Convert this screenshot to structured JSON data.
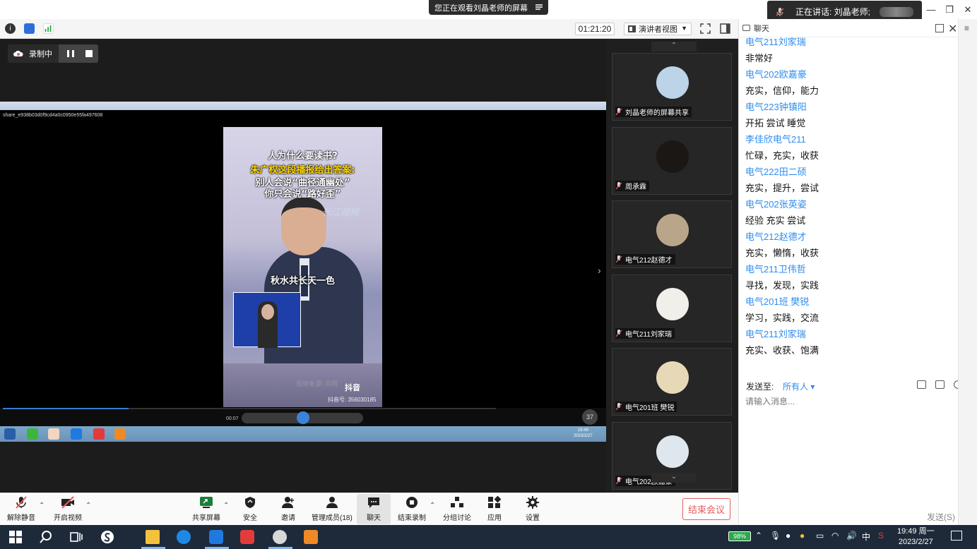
{
  "top": {
    "viewing_banner": "您正在观看刘晶老师的屏幕",
    "speaker_label": "正在讲话: 刘晶老师;"
  },
  "toolbar": {
    "timer": "01:21:20",
    "view_label": "演讲者视图"
  },
  "recording": {
    "label": "录制中"
  },
  "shared": {
    "window_title": "share_e938b03d0f9cd4a0c0950e55fa497608",
    "headline_1": "人为什么要读书?",
    "headline_2": "朱广权这段播报给出答案:",
    "headline_3": "别人会说“曲径通幽处”",
    "headline_4": "你只会说“路好歪”",
    "watermark": "长江视频",
    "subtitle": "秋水共长天一色",
    "source_watermark": "视频来源: 共同",
    "tiktok": "抖音",
    "tiktok_id": "抖音号: 356030185",
    "player_time": "00:07",
    "speed": "37",
    "mini_clock_time": "19:49",
    "mini_clock_date": "2023/2/27"
  },
  "participants": [
    {
      "name": "刘晶老师的屏幕共享",
      "avatar_color": "#bcd3e8"
    },
    {
      "name": "周承霖",
      "avatar_color": "#1a1714"
    },
    {
      "name": "电气212赵德才",
      "avatar_color": "#b9a58a"
    },
    {
      "name": "电气211刘家瑞",
      "avatar_color": "#f0efe9"
    },
    {
      "name": "电气201班 樊锐",
      "avatar_color": "#e7d9b8"
    },
    {
      "name": "电气202欧嘉豪",
      "avatar_color": "#dfe7ee"
    }
  ],
  "chat": {
    "title": "聊天",
    "messages": [
      {
        "sender": "电气211刘家瑞",
        "text": "非常好"
      },
      {
        "sender": "电气202欧嘉豪",
        "text": "充实，信仰，能力"
      },
      {
        "sender": "电气223钟镇阳",
        "text": "开拓 尝试 睡觉"
      },
      {
        "sender": "李佳欣电气211",
        "text": "忙碌，充实，收获"
      },
      {
        "sender": "电气222田二硕",
        "text": "充实，提升，尝试"
      },
      {
        "sender": "电气202张英姿",
        "text": "经验 充实 尝试"
      },
      {
        "sender": "电气212赵德才",
        "text": "充实，懒惰，收获"
      },
      {
        "sender": "电气211卫伟哲",
        "text": "寻找，发现，实践"
      },
      {
        "sender": "电气201班 樊锐",
        "text": "学习，实践，交流"
      },
      {
        "sender": "电气211刘家瑞",
        "text": "充实、收获、饱满"
      }
    ],
    "send_to_label": "发送至:",
    "send_target": "所有人",
    "input_placeholder": "请输入消息...",
    "send_button": "发送(S)"
  },
  "bottombar": {
    "unmute": "解除静音",
    "start_video": "开启视频",
    "share_screen": "共享屏幕",
    "security": "安全",
    "invite": "邀请",
    "participants": "管理成员(18)",
    "chat": "聊天",
    "stop_recording": "结束录制",
    "breakout": "分组讨论",
    "apps": "应用",
    "settings": "设置",
    "end_meeting": "结束会议"
  },
  "taskbar": {
    "battery": "98%",
    "ime": "中",
    "time": "19:49 周一",
    "date": "2023/2/27"
  },
  "colors": {
    "accent_blue": "#2d8cf0",
    "end_red": "#e35d5d"
  }
}
